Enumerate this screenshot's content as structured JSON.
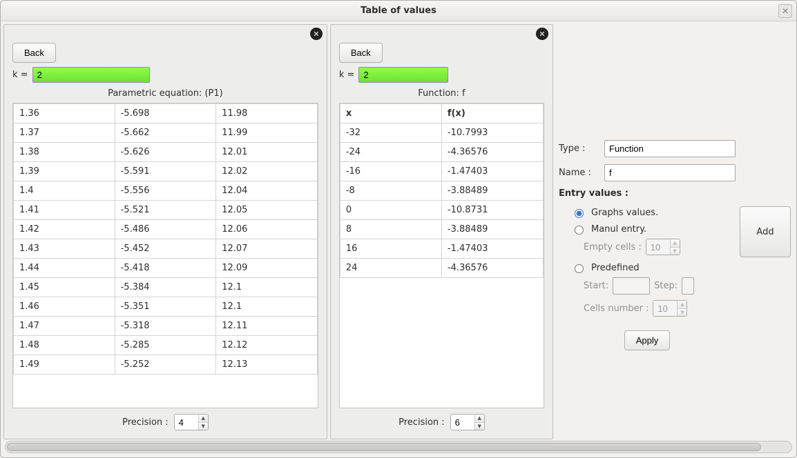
{
  "window": {
    "title": "Table of values"
  },
  "common": {
    "back_label": "Back",
    "k_label": "k = ",
    "precision_label": "Precision :"
  },
  "left_panel": {
    "k_value": "2",
    "heading": "Parametric equation: (P1)",
    "precision_value": "4",
    "rows": [
      [
        "1.36",
        "-5.698",
        "11.98"
      ],
      [
        "1.37",
        "-5.662",
        "11.99"
      ],
      [
        "1.38",
        "-5.626",
        "12.01"
      ],
      [
        "1.39",
        "-5.591",
        "12.02"
      ],
      [
        "1.4",
        "-5.556",
        "12.04"
      ],
      [
        "1.41",
        "-5.521",
        "12.05"
      ],
      [
        "1.42",
        "-5.486",
        "12.06"
      ],
      [
        "1.43",
        "-5.452",
        "12.07"
      ],
      [
        "1.44",
        "-5.418",
        "12.09"
      ],
      [
        "1.45",
        "-5.384",
        "12.1"
      ],
      [
        "1.46",
        "-5.351",
        "12.1"
      ],
      [
        "1.47",
        "-5.318",
        "12.11"
      ],
      [
        "1.48",
        "-5.285",
        "12.12"
      ],
      [
        "1.49",
        "-5.252",
        "12.13"
      ]
    ]
  },
  "mid_panel": {
    "k_value": "2",
    "heading": "Function: f",
    "precision_value": "6",
    "headers": [
      "x",
      "f(x)"
    ],
    "rows": [
      [
        "-32",
        "-10.7993"
      ],
      [
        "-24",
        "-4.36576"
      ],
      [
        "-16",
        "-1.47403"
      ],
      [
        "-8",
        "-3.88489"
      ],
      [
        "0",
        "-10.8731"
      ],
      [
        "8",
        "-3.88489"
      ],
      [
        "16",
        "-1.47403"
      ],
      [
        "24",
        "-4.36576"
      ]
    ]
  },
  "sidebar": {
    "type_label": "Type :",
    "type_value": "Function",
    "name_label": "Name :",
    "name_value": "f",
    "entry_label": "Entry values :",
    "radio_graphs": "Graphs values.",
    "radio_manual": "Manul entry.",
    "empty_cells_label": "Empty cells :",
    "empty_cells_value": "10",
    "radio_predefined": "Predefined",
    "start_label": "Start:",
    "step_label": "Step:",
    "cells_number_label": "Cells number :",
    "cells_number_value": "10",
    "apply_label": "Apply",
    "add_label": "Add"
  }
}
